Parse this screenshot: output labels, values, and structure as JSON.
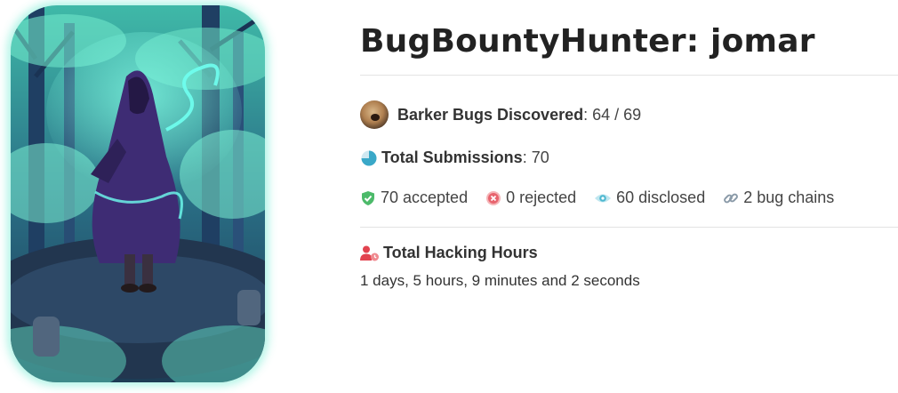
{
  "profile": {
    "title": "BugBountyHunter: jomar",
    "barker_label": "Barker Bugs Discovered",
    "barker_value": ": 64 / 69",
    "submissions_label": "Total Submissions",
    "submissions_value": ": 70",
    "stats": {
      "accepted": "70 accepted",
      "rejected": "0 rejected",
      "disclosed": "60 disclosed",
      "chains": "2 bug chains"
    },
    "hours_label": "Total Hacking Hours",
    "hours_value": "1 days, 5 hours, 9 minutes and 2 seconds"
  },
  "icons": {
    "avatar": "hooded-hacker-illustration",
    "barker": "dog-avatar-icon",
    "submissions": "pie-chart-icon",
    "accepted": "check-shield-icon",
    "rejected": "x-circle-icon",
    "disclosed": "eye-icon",
    "chains": "link-icon",
    "hours": "user-clock-icon"
  },
  "colors": {
    "accepted": "#4cba6a",
    "rejected": "#e8646e",
    "disclosed": "#4fb8d0",
    "chains": "#8a9aa8",
    "hours": "#e2434f",
    "pie": "#3aa8c8"
  }
}
